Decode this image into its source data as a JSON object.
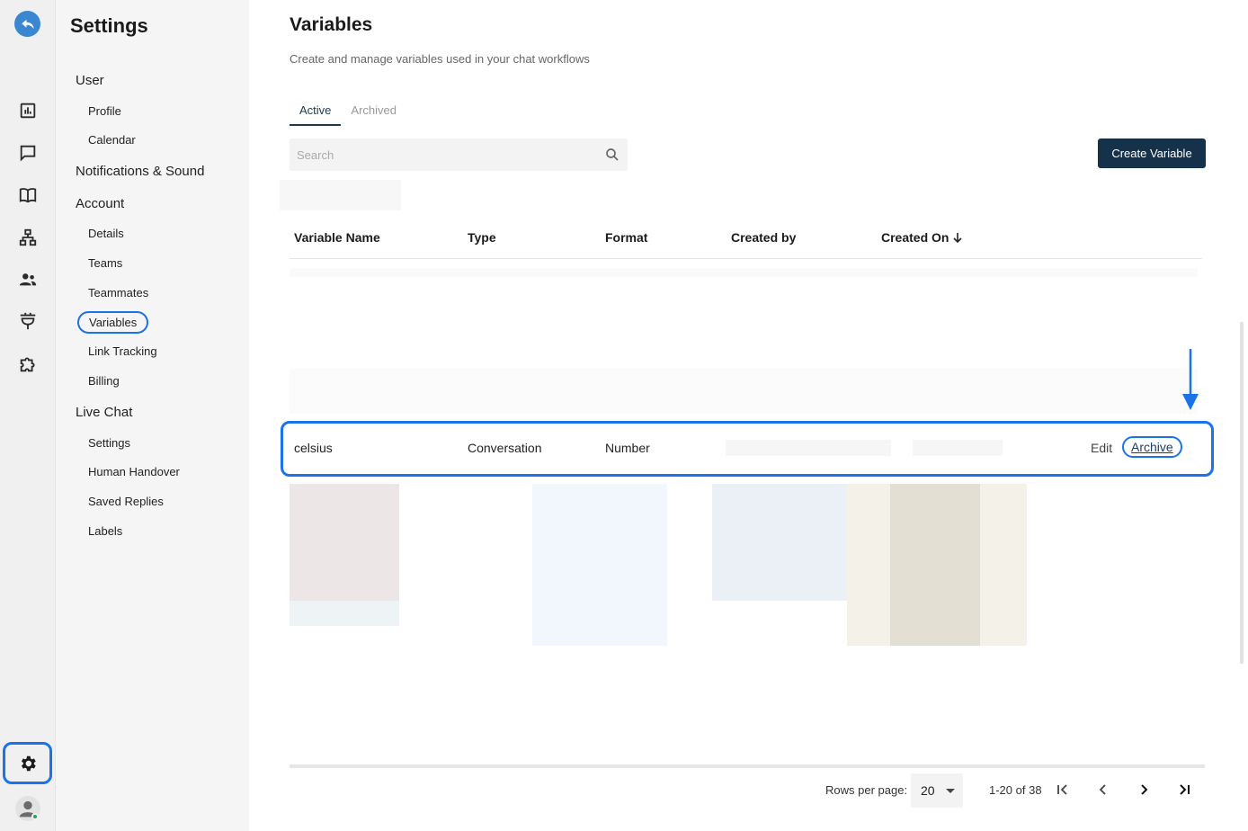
{
  "settings": {
    "title": "Settings",
    "sections": [
      {
        "label": "User",
        "items": [
          "Profile",
          "Calendar"
        ]
      },
      {
        "label": "Notifications & Sound",
        "items": []
      },
      {
        "label": "Account",
        "items": [
          "Details",
          "Teams",
          "Teammates",
          "Variables",
          "Link Tracking",
          "Billing"
        ]
      },
      {
        "label": "Live Chat",
        "items": [
          "Settings",
          "Human Handover",
          "Saved Replies",
          "Labels"
        ]
      }
    ],
    "active_item": "Variables"
  },
  "rail": {
    "icons": [
      "back-icon",
      "analytics-icon",
      "chat-icon",
      "book-icon",
      "sitemap-icon",
      "contacts-icon",
      "integrations-icon",
      "puzzle-icon",
      "gear-icon",
      "avatar-icon"
    ],
    "accent": "#1a73e8"
  },
  "page": {
    "title": "Variables",
    "subtitle": "Create and manage variables used in your chat workflows",
    "tabs": [
      "Active",
      "Archived"
    ],
    "active_tab": "Active",
    "search_placeholder": "Search",
    "create_button": "Create Variable"
  },
  "table": {
    "columns": [
      "Variable Name",
      "Type",
      "Format",
      "Created by",
      "Created On"
    ],
    "sort_column": "Created On",
    "rows": [
      {
        "name": "celsius",
        "type": "Conversation",
        "format": "Number",
        "edit": "Edit",
        "archive": "Archive"
      }
    ]
  },
  "pagination": {
    "rows_per_page_label": "Rows per page:",
    "rows_per_page": "20",
    "range": "1-20 of 38"
  },
  "colors": {
    "primary": "#15324a",
    "highlight": "#1a73e8"
  }
}
